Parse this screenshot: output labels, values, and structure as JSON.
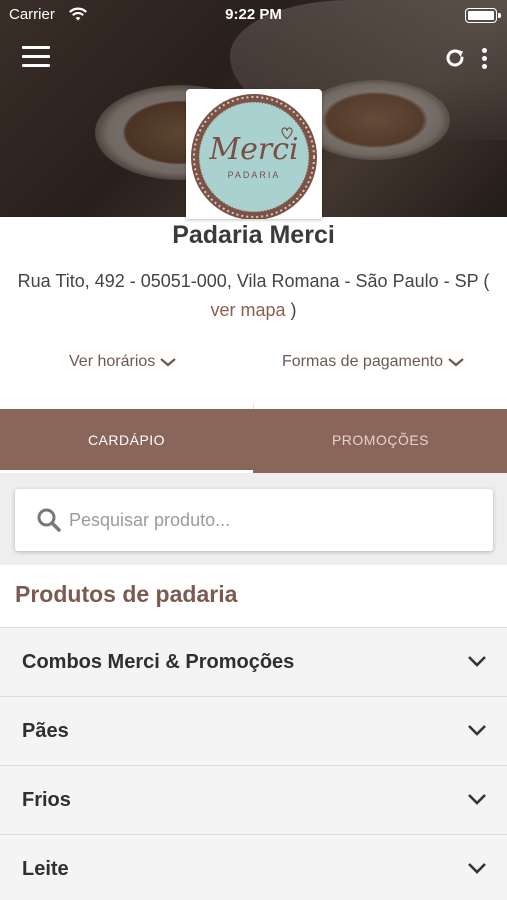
{
  "status_bar": {
    "carrier": "Carrier",
    "time": "9:22 PM"
  },
  "logo": {
    "brand": "Merci",
    "subtitle": "PADARIA"
  },
  "store": {
    "name": "Padaria Merci",
    "address": "Rua Tito, 492 - 05051-000, Vila Romana - São Paulo - SP",
    "map_open": "(",
    "map_link": "ver mapa",
    "map_close": ")"
  },
  "links": {
    "hours": "Ver horários",
    "payment": "Formas de pagamento"
  },
  "tabs": [
    {
      "label": "CARDÁPIO",
      "active": true
    },
    {
      "label": "PROMOÇÕES",
      "active": false
    }
  ],
  "search": {
    "placeholder": "Pesquisar produto..."
  },
  "section": {
    "title": "Produtos de padaria"
  },
  "categories": [
    {
      "label": "Combos Merci & Promoções"
    },
    {
      "label": "Pães"
    },
    {
      "label": "Frios"
    },
    {
      "label": "Leite"
    }
  ],
  "colors": {
    "brand": "#8a665a",
    "section_title": "#7d5a4f",
    "link": "#8b5e4e"
  },
  "icons": [
    "menu-icon",
    "refresh-icon",
    "more-vertical-icon",
    "wifi-icon",
    "battery-icon",
    "search-icon",
    "chevron-down-icon"
  ]
}
